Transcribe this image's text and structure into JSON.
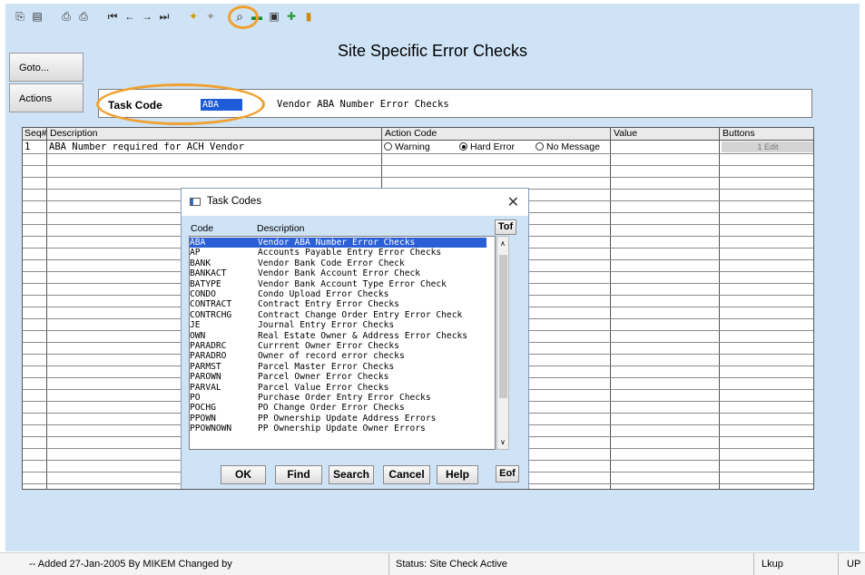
{
  "window": {
    "title": "Site Specific Error Checks"
  },
  "toolbar": {
    "icons": [
      "copy-icon",
      "paste-icon",
      "print-icon",
      "print-preview-icon",
      "first-record-icon",
      "previous-record-icon",
      "next-record-icon",
      "last-record-icon",
      "clear-icon",
      "delete-icon",
      "search-icon",
      "save-icon",
      "properties-icon",
      "import-icon",
      "report-icon"
    ],
    "highlight_color": "#f0a030"
  },
  "side_buttons": {
    "goto": "Goto...",
    "actions": "Actions"
  },
  "task": {
    "label": "Task Code",
    "code": "ABA",
    "description": "Vendor ABA Number Error Checks"
  },
  "grid": {
    "headers": {
      "seq": "Seq#",
      "description": "Description",
      "action_code": "Action Code",
      "value": "Value",
      "buttons": "Buttons"
    },
    "rows": [
      {
        "seq": "1",
        "description": "ABA Number required for ACH Vendor",
        "options": [
          "Warning",
          "Hard Error",
          "No Message"
        ],
        "selected": "Hard Error",
        "value": "",
        "button": "1 Edit"
      }
    ]
  },
  "dialog": {
    "title": "Task Codes",
    "col_code": "Code",
    "col_desc": "Description",
    "items": [
      {
        "code": "ABA",
        "desc": "Vendor ABA Number Error Checks"
      },
      {
        "code": "AP",
        "desc": "Accounts Payable Entry Error Checks"
      },
      {
        "code": "BANK",
        "desc": "Vendor Bank Code Error Check"
      },
      {
        "code": "BANKACT",
        "desc": "Vendor Bank Account Error Check"
      },
      {
        "code": "BATYPE",
        "desc": "Vendor Bank Account Type Error Check"
      },
      {
        "code": "CONDO",
        "desc": "Condo Upload Error Checks"
      },
      {
        "code": "CONTRACT",
        "desc": "Contract Entry Error Checks"
      },
      {
        "code": "CONTRCHG",
        "desc": "Contract Change Order Entry Error Check"
      },
      {
        "code": "JE",
        "desc": "Journal Entry Error Checks"
      },
      {
        "code": "OWN",
        "desc": "Real Estate Owner & Address Error Checks"
      },
      {
        "code": "PARADRC",
        "desc": "Currrent Owner Error Checks"
      },
      {
        "code": "PARADRO",
        "desc": "Owner of record error checks"
      },
      {
        "code": "PARMST",
        "desc": "Parcel Master Error Checks"
      },
      {
        "code": "PAROWN",
        "desc": "Parcel Owner Error Checks"
      },
      {
        "code": "PARVAL",
        "desc": "Parcel Value Error Checks"
      },
      {
        "code": "PO",
        "desc": "Purchase Order Entry Error Checks"
      },
      {
        "code": "POCHG",
        "desc": "PO Change Order Error Checks"
      },
      {
        "code": "PPOWN",
        "desc": "PP Ownership Update Address Errors"
      },
      {
        "code": "PPOWNOWN",
        "desc": "PP Ownership Update Owner Errors"
      }
    ],
    "selected_index": 0,
    "tof": "Tof",
    "eof": "Eof",
    "buttons": {
      "ok": "OK",
      "find": "Find",
      "search": "Search",
      "cancel": "Cancel",
      "help": "Help"
    }
  },
  "status": {
    "left": "-- Added 27-Jan-2005 By MIKEM Changed  by",
    "mid": "Status: Site Check Active",
    "lkup": "Lkup",
    "mode": "UP"
  }
}
